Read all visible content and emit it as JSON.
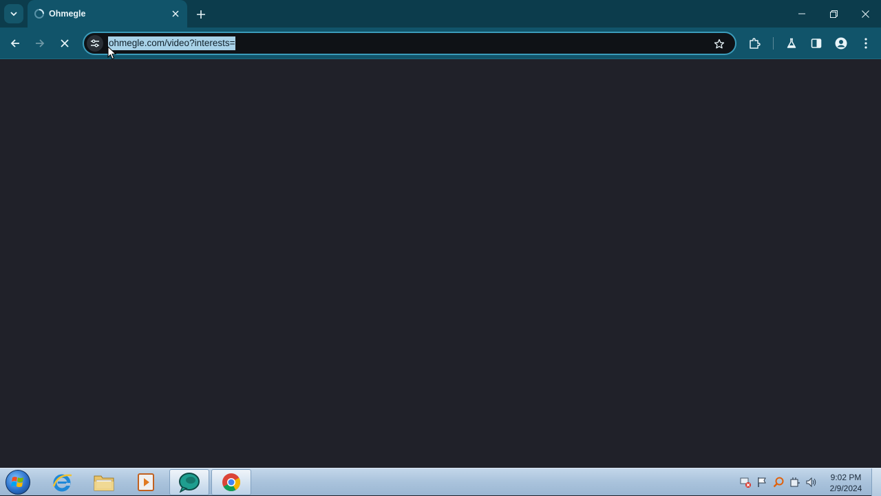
{
  "browser": {
    "tab": {
      "title": "Ohmegle"
    },
    "omnibox": {
      "url": "ohmegle.com/video?interests="
    }
  },
  "taskbar": {
    "clock": {
      "time": "9:02 PM",
      "date": "2/9/2024"
    },
    "apps": [
      "internet-explorer",
      "file-explorer",
      "media-player",
      "ohmegle-app",
      "chrome"
    ]
  },
  "colors": {
    "tabstrip": "#0c3c4c",
    "toolbar": "#11546a",
    "omnibox_border": "#3b9cbb",
    "url_selection": "#a8d2e8",
    "page_background": "#202129"
  }
}
